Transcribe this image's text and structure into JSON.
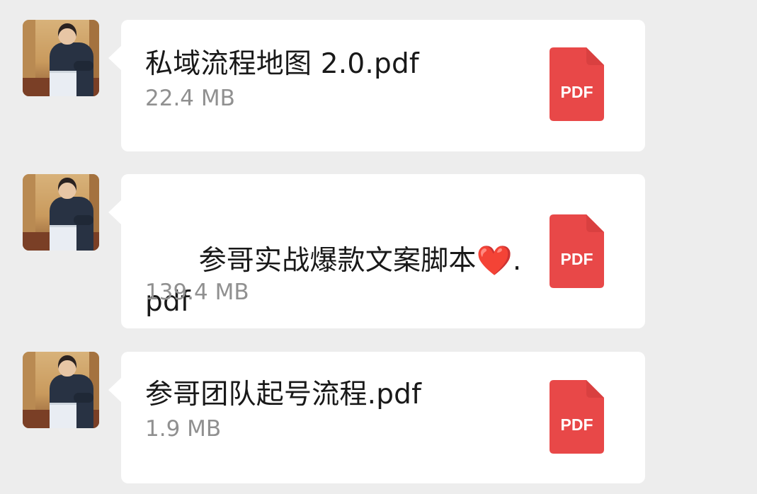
{
  "messages": [
    {
      "file_name": "私域流程地图 2.0.pdf",
      "file_size": "22.4 MB",
      "file_type": "PDF"
    },
    {
      "file_name_part1": "参哥实战爆款文案脚本",
      "file_name_part2": ".pdf",
      "file_name_heart": "❤️",
      "file_size": "139.4 MB",
      "file_type": "PDF"
    },
    {
      "file_name": "参哥团队起号流程.pdf",
      "file_size": "1.9 MB",
      "file_type": "PDF"
    }
  ],
  "colors": {
    "background": "#ededed",
    "bubble": "#ffffff",
    "file_name": "#191919",
    "file_size": "#909090",
    "pdf_red": "#e84848",
    "pdf_fold": "#d94040"
  },
  "icons": {
    "avatar": "avatar-icon",
    "pdf": "pdf-file-icon"
  }
}
